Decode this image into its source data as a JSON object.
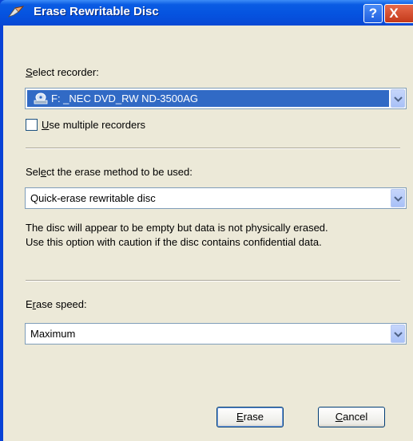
{
  "window": {
    "title": "Erase Rewritable Disc",
    "help_glyph": "?",
    "close_glyph": "X"
  },
  "recorder": {
    "label_prefix": "",
    "label_accel": "S",
    "label_rest": "elect recorder:",
    "selected": "F: _NEC DVD_RW ND-3500AG"
  },
  "multiple_recorders": {
    "accel": "U",
    "rest": "se multiple recorders",
    "checked": false
  },
  "erase_method": {
    "label_prefix": "Sel",
    "label_accel": "e",
    "label_rest": "ct the erase method to be used:",
    "selected": "Quick-erase rewritable disc",
    "description_line1": "The disc will appear to be empty but data is not physically erased.",
    "description_line2": "Use this option with caution if the disc contains confidential data."
  },
  "erase_speed": {
    "label_prefix": "E",
    "label_accel": "r",
    "label_rest": "ase speed:",
    "selected": "Maximum"
  },
  "buttons": {
    "erase_accel": "E",
    "erase_rest": "rase",
    "cancel_accel": "C",
    "cancel_rest": "ancel"
  },
  "colors": {
    "titlebar": "#0553e0",
    "dialog_bg": "#ece9d8",
    "selection": "#316ac5"
  }
}
